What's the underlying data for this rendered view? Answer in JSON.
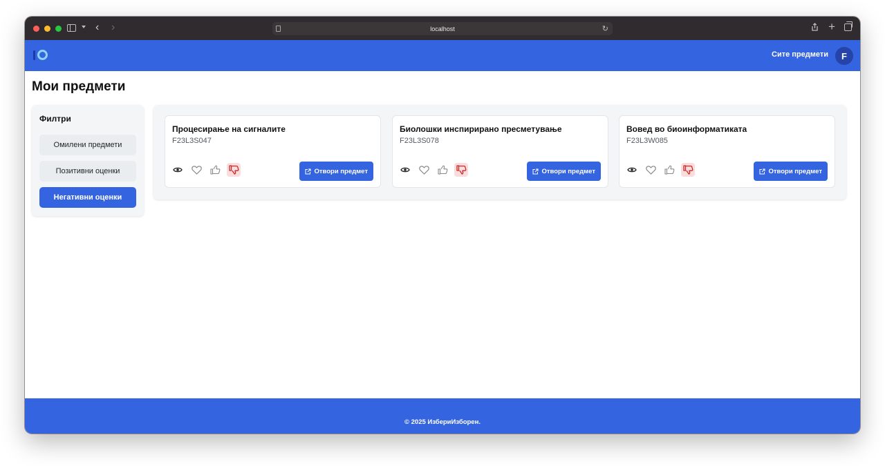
{
  "browser": {
    "url": "localhost"
  },
  "header": {
    "nav_link": "Сите предмети",
    "avatar_initial": "F"
  },
  "page": {
    "title": "Мои предмети"
  },
  "filters": {
    "title": "Филтри",
    "items": [
      {
        "label": "Омилени предмети",
        "active": false
      },
      {
        "label": "Позитивни оценки",
        "active": false
      },
      {
        "label": "Негативни оценки",
        "active": true
      }
    ]
  },
  "courses": [
    {
      "title": "Процесирање на сигналите",
      "code": "F23L3S047",
      "open_label": "Отвори предмет",
      "disliked": true
    },
    {
      "title": "Биолошки инспирирано пресметување",
      "code": "F23L3S078",
      "open_label": "Отвори предмет",
      "disliked": true
    },
    {
      "title": "Вовед во биоинформатиката",
      "code": "F23L3W085",
      "open_label": "Отвори предмет",
      "disliked": true
    }
  ],
  "footer": {
    "text": "© 2025 ИзбериИзборен."
  },
  "colors": {
    "primary": "#3564e0",
    "dislike_bg": "#fbdcdc",
    "dislike_icon": "#c62828"
  }
}
